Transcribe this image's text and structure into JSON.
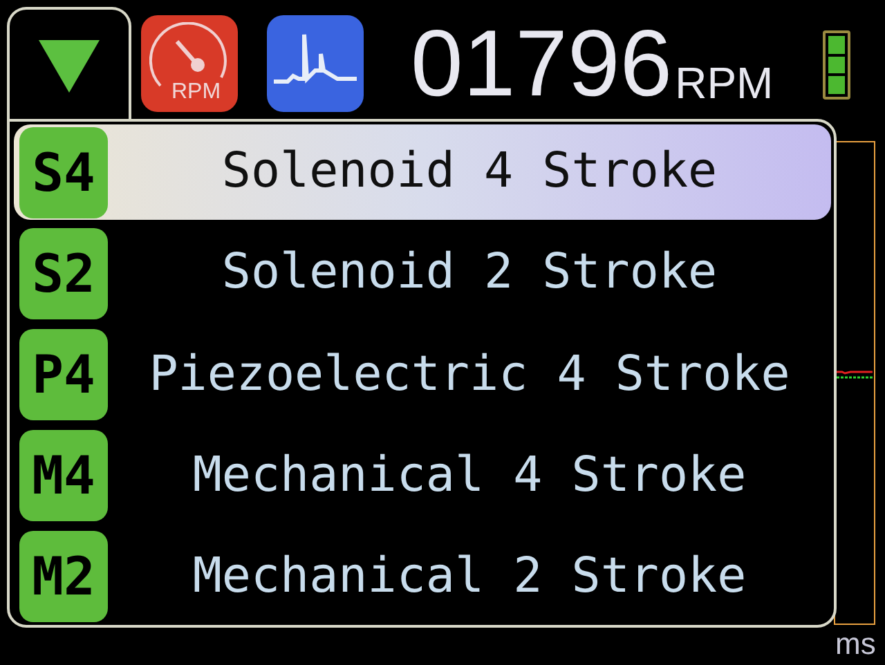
{
  "header": {
    "gauge_label": "RPM",
    "rpm_value": "01796",
    "rpm_unit": "RPM"
  },
  "sensor_types": [
    {
      "code": "S4",
      "label": "Solenoid 4 Stroke",
      "selected": true
    },
    {
      "code": "S2",
      "label": "Solenoid 2 Stroke",
      "selected": false
    },
    {
      "code": "P4",
      "label": "Piezoelectric 4 Stroke",
      "selected": false
    },
    {
      "code": "M4",
      "label": "Mechanical 4 Stroke",
      "selected": false
    },
    {
      "code": "M2",
      "label": "Mechanical 2 Stroke",
      "selected": false
    }
  ],
  "scope": {
    "unit": "ms"
  }
}
